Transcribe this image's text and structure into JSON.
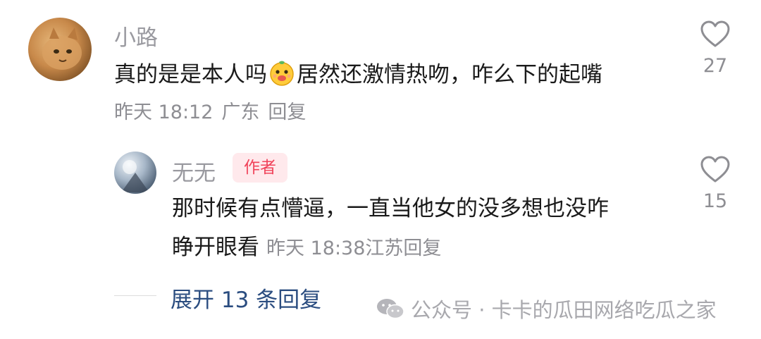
{
  "comment": {
    "username": "小路",
    "text_before_emoji": "真的是是本人吗",
    "emoji": "face-emoji",
    "text_after_emoji": "居然还激情热吻，咋么下的起嘴",
    "time": "昨天 18:12",
    "location": "广东",
    "reply_label": "回复",
    "likes": "27"
  },
  "reply": {
    "username": "无无",
    "badge": "作者",
    "text_line1": "那时候有点懵逼，一直当他女的没多想也没咋",
    "text_line2": "睁开眼看",
    "time": "昨天 18:38",
    "location": "江苏",
    "reply_label": "回复",
    "likes": "15"
  },
  "expand_label": "展开 13 条回复",
  "watermark": "公众号 · 卡卡的瓜田网络吃瓜之家",
  "colors": {
    "username": "#9a9aa0",
    "text": "#1a1a1a",
    "meta": "#8e8e93",
    "badge_bg": "#ffe9ec",
    "badge_text": "#f0435a",
    "expand": "#2b4d80"
  }
}
